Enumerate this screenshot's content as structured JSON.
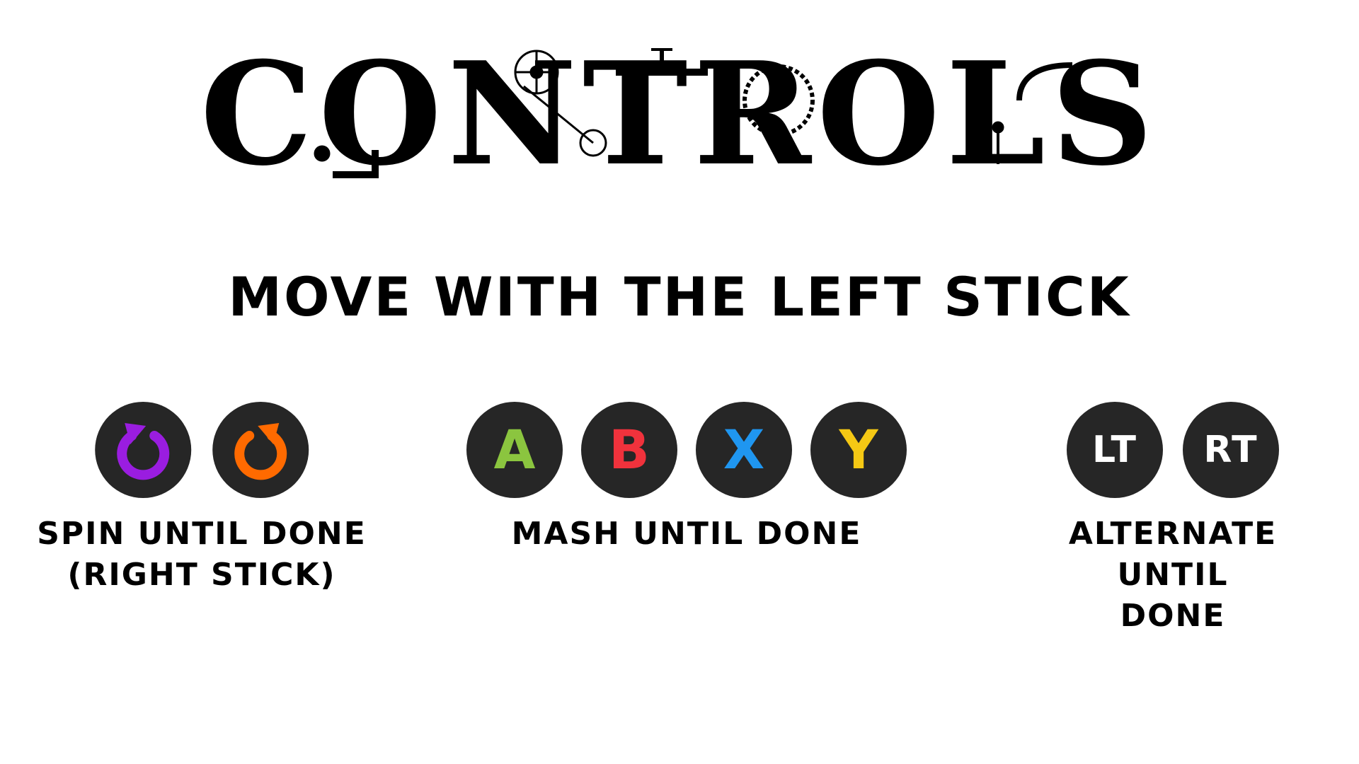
{
  "title": {
    "text": "CONTROLS"
  },
  "subtitle": "MOVE WITH THE LEFT STICK",
  "groups": {
    "spin": {
      "caption": "SPIN UNTIL DONE\n(RIGHT STICK)",
      "icons": [
        {
          "name": "clockwise-rotate-icon",
          "color": "#9a1de0"
        },
        {
          "name": "counterclockwise-rotate-icon",
          "color": "#ff6a00"
        }
      ]
    },
    "mash": {
      "caption": "MASH UNTIL DONE",
      "buttons": [
        {
          "label": "A",
          "color": "#8bc53f"
        },
        {
          "label": "B",
          "color": "#f0323c"
        },
        {
          "label": "X",
          "color": "#1f96f0"
        },
        {
          "label": "Y",
          "color": "#f5c814"
        }
      ]
    },
    "alternate": {
      "caption": "ALTERNATE\nUNTIL DONE",
      "buttons": [
        {
          "label": "LT"
        },
        {
          "label": "RT"
        }
      ]
    }
  },
  "colors": {
    "background": "#ffffff",
    "button_fill": "#262626",
    "text": "#000000"
  }
}
